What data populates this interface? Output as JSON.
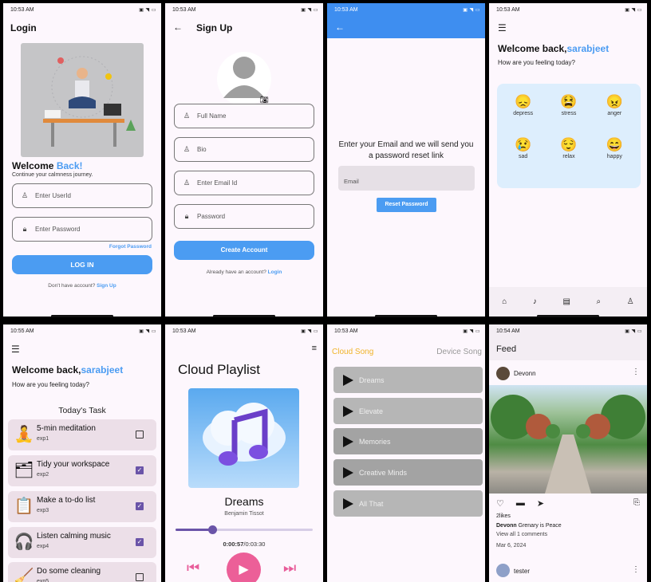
{
  "screens": {
    "login": {
      "time": "10:53 AM",
      "title": "Login",
      "welcome_text": "Welcome ",
      "welcome_accent": "Back!",
      "tagline": "Continue your calmness journey.",
      "userid_placeholder": "Enter UserId",
      "password_placeholder": "Enter Password",
      "forgot": "Forgot Password",
      "login_button": "LOG IN",
      "no_account": "Don't have account?",
      "signup_link": "Sign Up"
    },
    "signup": {
      "time": "10:53 AM",
      "title": "Sign Up",
      "fullname": "Full Name",
      "bio": "Bio",
      "email": "Enter Email Id",
      "password": "Password",
      "create_button": "Create Account",
      "have_account": "Already have an account?",
      "login_link": "Login"
    },
    "reset": {
      "time": "10:53 AM",
      "message": "Enter your Email and we will send you a password reset link",
      "email_placeholder": "Email",
      "reset_button": "Reset Password"
    },
    "home": {
      "time": "10:53 AM",
      "welcome": "Welcome back,",
      "username": "sarabjeet",
      "question": "How are you feeling today?",
      "moods": [
        {
          "label": "depress",
          "icon": "depress-icon"
        },
        {
          "label": "stress",
          "icon": "stress-icon"
        },
        {
          "label": "anger",
          "icon": "anger-icon"
        },
        {
          "label": "sad",
          "icon": "sad-icon"
        },
        {
          "label": "relax",
          "icon": "relax-icon"
        },
        {
          "label": "happy",
          "icon": "happy-icon"
        }
      ],
      "nav": [
        "home-icon",
        "music-icon",
        "journal-icon",
        "search-icon",
        "profile-icon"
      ]
    },
    "tasks": {
      "time": "10:55 AM",
      "welcome": "Welcome back,",
      "username": "sarabjeet",
      "question": "How are you feeling today?",
      "section": "Today's Task",
      "items": [
        {
          "title": "5-min meditation",
          "xp": "exp1",
          "done": false
        },
        {
          "title": "Tidy your workspace",
          "xp": "exp2",
          "done": true
        },
        {
          "title": "Make a to-do list",
          "xp": "exp3",
          "done": true
        },
        {
          "title": "Listen calming music",
          "xp": "exp4",
          "done": true
        },
        {
          "title": "Do some cleaning",
          "xp": "exp5",
          "done": false
        }
      ]
    },
    "player": {
      "time": "10:53 AM",
      "title": "Cloud Playlist",
      "song": "Dreams",
      "artist": "Benjamin Tissot",
      "elapsed": "0:00:57",
      "total": "/0:03:30",
      "progress": 0.27
    },
    "songs": {
      "time": "10:53 AM",
      "tab_cloud": "Cloud Song",
      "tab_device": "Device Song",
      "list": [
        "Dreams",
        "Elevate",
        "Memories",
        "Creative Minds",
        "All That"
      ]
    },
    "feed": {
      "time": "10:54 AM",
      "title": "Feed",
      "author": "Devonn",
      "likes": "2likes",
      "caption_user": "Devonn",
      "caption": "Grenary is Peace",
      "comments": "View all 1 comments",
      "date": "Mar 6, 2024",
      "next_author": "tester"
    }
  },
  "colors": {
    "accent": "#4b9cf2",
    "pink": "#e85d9a",
    "purple": "#6a54a8",
    "orange": "#f0b429"
  }
}
